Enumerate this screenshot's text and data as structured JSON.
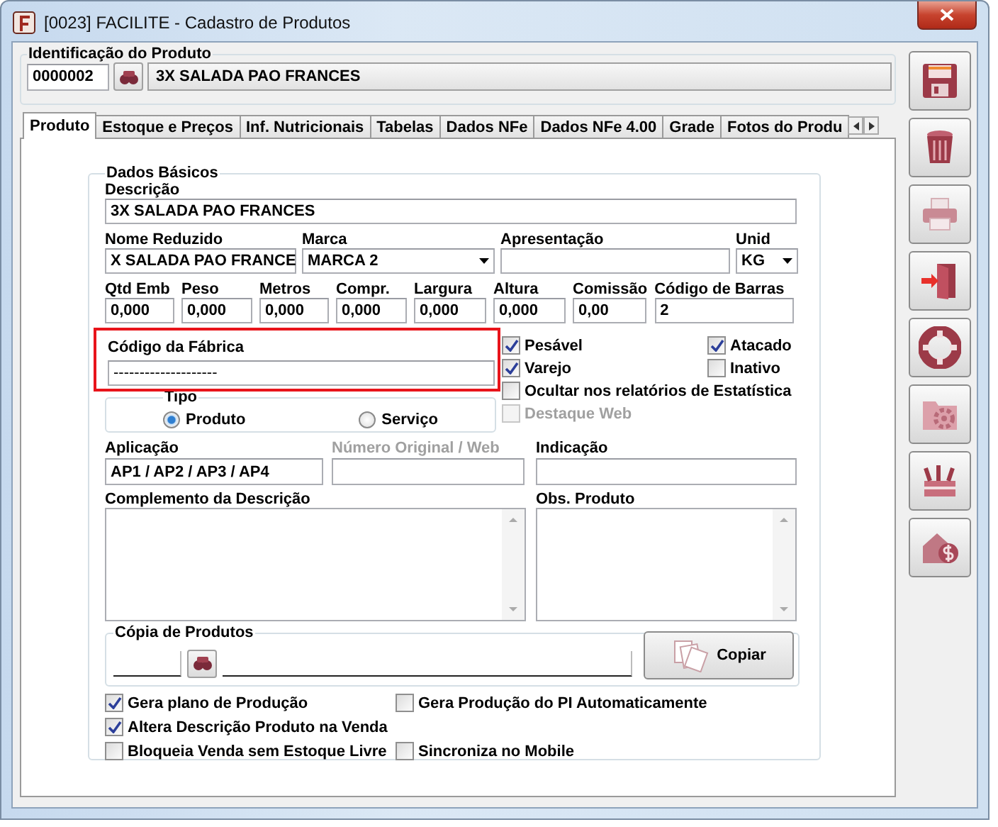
{
  "window": {
    "title": "[0023] FACILITE - Cadastro de Produtos"
  },
  "identification": {
    "title": "Identificação do Produto",
    "code": "0000002",
    "name": "3X SALADA PAO FRANCES"
  },
  "tabs": [
    {
      "label": "Produto",
      "selected": true
    },
    {
      "label": "Estoque e Preços",
      "selected": false
    },
    {
      "label": "Inf. Nutricionais",
      "selected": false
    },
    {
      "label": "Tabelas",
      "selected": false
    },
    {
      "label": "Dados NFe",
      "selected": false
    },
    {
      "label": "Dados NFe 4.00",
      "selected": false
    },
    {
      "label": "Grade",
      "selected": false
    },
    {
      "label": "Fotos do Produ",
      "selected": false
    }
  ],
  "basic_data": {
    "title": "Dados Básicos",
    "description": {
      "label": "Descrição",
      "value": "3X SALADA PAO FRANCES",
      "kind": "text"
    },
    "details": [
      {
        "label": "Nome Reduzido",
        "value": "X SALADA PAO FRANCE",
        "kind": "text"
      },
      {
        "label": "Marca",
        "value": "MARCA 2",
        "kind": "select"
      },
      {
        "label": "Apresentação",
        "kind": "text"
      },
      {
        "label": "Unid",
        "value": "KG",
        "kind": "select"
      }
    ],
    "measures": [
      {
        "label": "Qtd Emb",
        "value": "0,000",
        "kind": "text"
      },
      {
        "label": "Peso",
        "value": "0,000",
        "kind": "text"
      },
      {
        "label": "Metros",
        "value": "0,000",
        "kind": "text"
      },
      {
        "label": "Compr.",
        "value": "0,000",
        "kind": "text"
      },
      {
        "label": "Largura",
        "value": "0,000",
        "kind": "text"
      },
      {
        "label": "Altura",
        "value": "0,000",
        "kind": "text"
      },
      {
        "label": "Comissão",
        "value": "0,00",
        "kind": "text"
      },
      {
        "label": "Código de Barras",
        "value": "2",
        "kind": "text"
      }
    ],
    "factory_code": {
      "label": "Código da Fábrica",
      "value": "--------------------",
      "highlighted": true
    },
    "type": {
      "title": "Tipo",
      "options": [
        {
          "label": "Produto",
          "selected": true
        },
        {
          "label": "Serviço",
          "selected": false
        }
      ]
    },
    "flags": [
      {
        "label": "Pesável",
        "checked": true,
        "disabled": false
      },
      {
        "label": "Atacado",
        "checked": true,
        "disabled": false
      },
      {
        "label": "Varejo",
        "checked": true,
        "disabled": false
      },
      {
        "label": "Inativo",
        "checked": false,
        "disabled": false
      },
      {
        "label": "Ocultar nos relatórios de Estatística",
        "checked": false,
        "disabled": false
      },
      {
        "label": "Destaque Web",
        "checked": false,
        "disabled": true
      }
    ],
    "lookup_row": [
      {
        "label": "Aplicação",
        "value": "AP1 / AP2 / AP3 / AP4",
        "disabled": false
      },
      {
        "label": "Número Original / Web",
        "disabled": true
      },
      {
        "label": "Indicação",
        "disabled": false
      }
    ],
    "memos": [
      {
        "label": "Complemento da Descrição"
      },
      {
        "label": "Obs. Produto"
      }
    ],
    "copy": {
      "title": "Cópia de Produtos",
      "button": "Copiar"
    },
    "options": [
      {
        "label": "Gera plano de Produção",
        "checked": true
      },
      {
        "label": "Gera Produção do PI Automaticamente",
        "checked": false
      },
      {
        "label": "Altera Descrição Produto na Venda",
        "checked": true
      },
      {
        "label": "Bloqueia Venda sem Estoque Livre",
        "checked": false
      },
      {
        "label": "Sincroniza no Mobile",
        "checked": false
      }
    ]
  },
  "toolbar": [
    {
      "kind": "save"
    },
    {
      "kind": "delete"
    },
    {
      "kind": "print"
    },
    {
      "kind": "exit"
    },
    {
      "kind": "help"
    },
    {
      "kind": "settings"
    },
    {
      "kind": "tools"
    },
    {
      "kind": "finance"
    }
  ]
}
